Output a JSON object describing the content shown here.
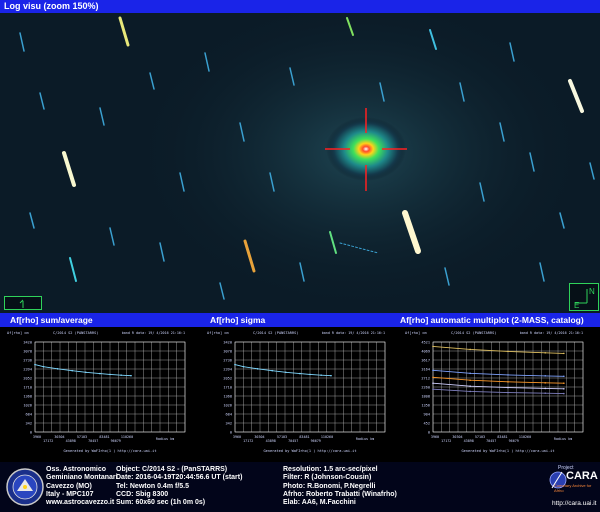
{
  "window": {
    "title": "Log visu (zoom 150%)"
  },
  "orientation": {
    "north_label": "N",
    "east_label": "E"
  },
  "panels": [
    {
      "title": "Af[rho] sum/average",
      "object": "C/2014 S2 (PANSTARRS)",
      "band": "band R data: 19/ 4/2016 21:16:1",
      "footer": "Generated by WaFIrho(1 ) http://cara.uai.it",
      "xlabel": "Radius km",
      "ylabel": "Af[rho] cm",
      "yticks": [
        "3420",
        "3078",
        "2736",
        "2394",
        "2052",
        "1710",
        "1368",
        "1026",
        "684",
        "342",
        "0"
      ],
      "xticks_top": [
        "3960",
        "30304",
        "57103",
        "83481",
        "110260"
      ],
      "xticks_bot": [
        "17172",
        "43898",
        "70457",
        "96679"
      ]
    },
    {
      "title": "Af[rho] sigma",
      "object": "C/2014 S2 (PANSTARRS)",
      "band": "band R data: 19/ 4/2016 21:16:1",
      "footer": "Generated by WaFIrho(1 ) http://cara.uai.it",
      "xlabel": "Radius km",
      "ylabel": "Af[rho] cm",
      "yticks": [
        "3420",
        "3078",
        "2736",
        "2394",
        "2052",
        "1710",
        "1368",
        "1026",
        "684",
        "342",
        "0"
      ],
      "xticks_top": [
        "3960",
        "30304",
        "57103",
        "83481",
        "110260"
      ],
      "xticks_bot": [
        "17172",
        "43898",
        "70457",
        "96679"
      ]
    },
    {
      "title": "Af[rho] automatic multiplot (2-MASS, catalog)",
      "object": "C/2014 S2 (PANSTARRS)",
      "band": "band R data: 19/ 4/2016 21:16:1",
      "footer": "Generated by WaFIrho(1 ) http://cara.uai.it",
      "xlabel": "Radius km",
      "ylabel": "Af[rho] cm",
      "yticks": [
        "4521",
        "4069",
        "3617",
        "3164",
        "2712",
        "2260",
        "1808",
        "1356",
        "904",
        "452",
        "0"
      ],
      "xticks_top": [
        "3960",
        "30304",
        "57103",
        "83481",
        "110260"
      ],
      "xticks_bot": [
        "17172",
        "43898",
        "70457",
        "96679"
      ]
    }
  ],
  "observatory": {
    "lines": [
      "Oss. Astronomico",
      "Geminiano Montanari",
      "Cavezzo (MO)",
      "Italy - MPC107",
      "www.astrocavezzo.it"
    ]
  },
  "observation": {
    "lines": [
      "Object: C/2014 S2 - (PanSTARRS)",
      "Date: 2016-04-19T20:44:56.6 UT (start)",
      "Tel: Newton 0.4m f/5.5",
      "CCD: Sbig 8300",
      "Sum: 60x60 sec (1h 0m 0s)"
    ]
  },
  "processing": {
    "lines": [
      "Resolution: 1.5 arc-sec/pixel",
      "Filter: R (Johnson-Cousin)",
      "Photo: R.Bonomi, P.Negrelli",
      "Afrho: Roberto Trabatti (Winafrho)",
      "Elab: AA6, M.Facchini"
    ]
  },
  "project": {
    "small": "Project",
    "name": "CARA",
    "tag": "Cometary Archive for Afrho",
    "url": "http://cara.uai.it"
  },
  "chart_data": [
    {
      "type": "line",
      "title": "Af[rho] sum/average",
      "xlabel": "Radius km",
      "ylabel": "Af[rho] cm",
      "xlim": [
        3960,
        110260
      ],
      "ylim": [
        0,
        3420
      ],
      "grid": true,
      "series": [
        {
          "x": [
            3960,
            10000,
            20000,
            30304,
            40000,
            50000,
            57103,
            65000,
            72000
          ],
          "values": [
            2560,
            2480,
            2400,
            2330,
            2270,
            2220,
            2190,
            2160,
            2140
          ]
        }
      ]
    },
    {
      "type": "line",
      "title": "Af[rho] sigma",
      "xlabel": "Radius km",
      "ylabel": "Af[rho] cm",
      "xlim": [
        3960,
        110260
      ],
      "ylim": [
        0,
        3420
      ],
      "grid": true,
      "series": [
        {
          "x": [
            3960,
            10000,
            20000,
            30304,
            40000,
            50000,
            57103,
            65000,
            72000
          ],
          "values": [
            2560,
            2480,
            2400,
            2330,
            2270,
            2220,
            2190,
            2160,
            2140
          ]
        }
      ]
    },
    {
      "type": "line",
      "title": "Af[rho] automatic multiplot (2-MASS, catalog)",
      "xlabel": "Radius km",
      "ylabel": "Af[rho] cm",
      "xlim": [
        3960,
        110260
      ],
      "ylim": [
        0,
        4521
      ],
      "grid": true,
      "series": [
        {
          "x": [
            3960,
            30304,
            57103,
            83481,
            96679
          ],
          "values": [
            4300,
            4150,
            4050,
            3980,
            3950
          ],
          "color": "#e0c060"
        },
        {
          "x": [
            3960,
            30304,
            57103,
            83481,
            96679
          ],
          "values": [
            3100,
            2950,
            2870,
            2820,
            2800
          ],
          "color": "#7fa3ff"
        },
        {
          "x": [
            3960,
            30304,
            57103,
            83481,
            96679
          ],
          "values": [
            2750,
            2600,
            2520,
            2470,
            2450
          ],
          "color": "#ff9a2a"
        },
        {
          "x": [
            3960,
            30304,
            57103,
            83481,
            96679
          ],
          "values": [
            2450,
            2300,
            2230,
            2190,
            2170
          ],
          "color": "#d0d0ff"
        },
        {
          "x": [
            3960,
            30304,
            57103,
            83481,
            96679
          ],
          "values": [
            2150,
            2040,
            1980,
            1950,
            1930
          ],
          "color": "#8080c0"
        }
      ]
    }
  ]
}
